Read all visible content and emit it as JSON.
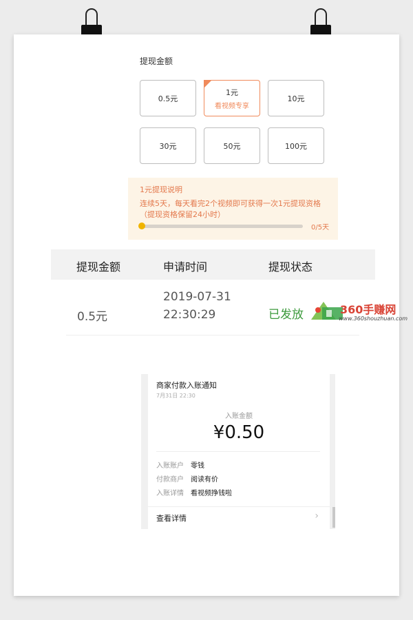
{
  "withdraw": {
    "title": "提现金额",
    "options": [
      {
        "label": "0.5元",
        "sub": ""
      },
      {
        "label": "1元",
        "sub": "看视频专享"
      },
      {
        "label": "10元",
        "sub": ""
      },
      {
        "label": "30元",
        "sub": ""
      },
      {
        "label": "50元",
        "sub": ""
      },
      {
        "label": "100元",
        "sub": ""
      }
    ],
    "selected_index": 1
  },
  "notice": {
    "title": "1元提现说明",
    "desc": "连续5天，每天看完2个视频即可获得一次1元提现资格（提现资格保留24小时）",
    "progress_text": "0/5天",
    "progress_value": 0
  },
  "table": {
    "headers": [
      "提现金额",
      "申请时间",
      "提现状态"
    ],
    "row": {
      "amount": "0.5元",
      "date": "2019-07-31",
      "time": "22:30:29",
      "status": "已发放"
    }
  },
  "watermark": {
    "text": "360手赚网",
    "url": "www.360shouzhuan.com"
  },
  "receipt": {
    "title": "商家付款入账通知",
    "date": "7月31日 22:30",
    "amount_label": "入账金额",
    "amount": "¥0.50",
    "rows": [
      {
        "key": "入账账户",
        "value": "零钱"
      },
      {
        "key": "付款商户",
        "value": "阅读有价"
      },
      {
        "key": "入账详情",
        "value": "看视频挣钱啦"
      }
    ],
    "more": "查看详情"
  },
  "colors": {
    "accent": "#f08a5b",
    "status_green": "#3c9a3c",
    "notice_bg": "#fdf4e6",
    "progress": "#f0b400"
  }
}
